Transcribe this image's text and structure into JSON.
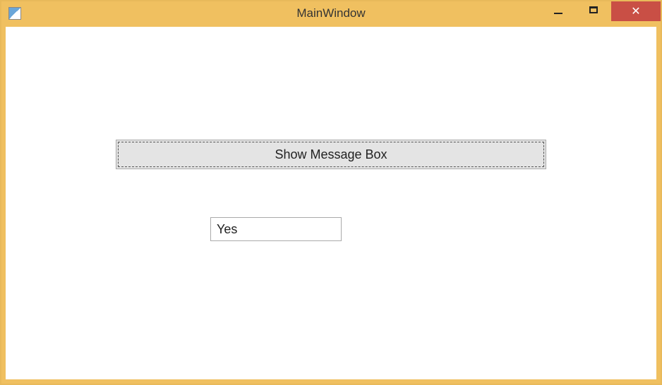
{
  "window": {
    "title": "MainWindow"
  },
  "controls": {
    "minimize": "minimize",
    "maximize": "maximize",
    "close": "✕"
  },
  "main": {
    "button_label": "Show Message Box",
    "result_value": "Yes"
  }
}
